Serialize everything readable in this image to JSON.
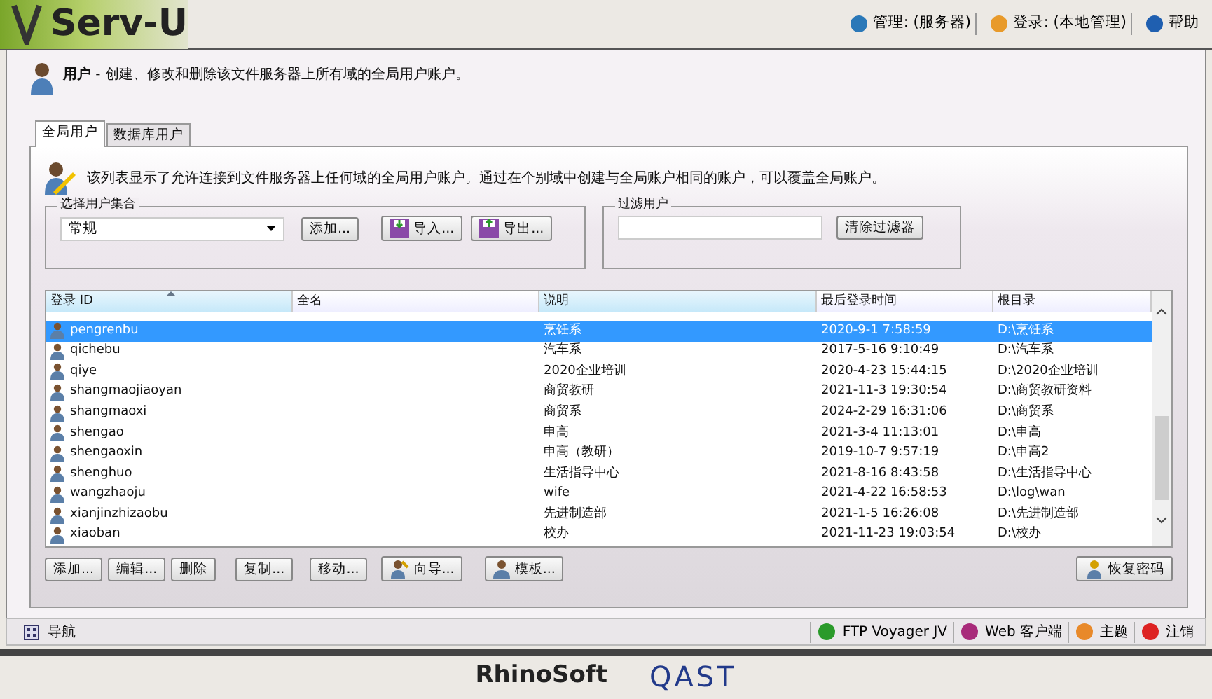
{
  "header": {
    "logo": "Serv-U",
    "toolbar": [
      {
        "kind": "server",
        "label": "管理: (服务器)"
      },
      {
        "kind": "user",
        "label": "登录: (本地管理)"
      },
      {
        "kind": "help",
        "label": "帮助"
      }
    ]
  },
  "page": {
    "title": "用户",
    "subtitle": " - 创建、修改和删除该文件服务器上所有域的全局用户账户。"
  },
  "tabs": [
    {
      "label": "全局用户",
      "selected": true
    },
    {
      "label": "数据库用户",
      "selected": false
    }
  ],
  "description": "该列表显示了允许连接到文件服务器上任何域的全局用户账户。通过在个别域中创建与全局账户相同的账户，可以覆盖全局账户。",
  "user_collection": {
    "legend": "选择用户集合",
    "value": "常规",
    "buttons": [
      {
        "kind": "plain",
        "label": "添加..."
      },
      {
        "kind": "import",
        "label": "导入..."
      },
      {
        "kind": "export",
        "label": "导出..."
      }
    ]
  },
  "filter": {
    "legend": "过滤用户",
    "button": "清除过滤器"
  },
  "table": {
    "columns": [
      "登录 ID",
      "全名",
      "说明",
      "最后登录时间",
      "根目录"
    ],
    "rows": [
      {
        "login_id": "pengrenbu",
        "description": "烹饪系",
        "last_login": "2020-9-1 7:58:59",
        "root": "D:\\烹饪系",
        "selected": true
      },
      {
        "login_id": "qichebu",
        "description": "汽车系",
        "last_login": "2017-5-16 9:10:49",
        "root": "D:\\汽车系",
        "selected": false
      },
      {
        "login_id": "qiye",
        "description": "2020企业培训",
        "last_login": "2020-4-23 15:44:15",
        "root": "D:\\2020企业培训",
        "selected": false
      },
      {
        "login_id": "shangmaojiaoyan",
        "description": "商贸教研",
        "last_login": "2021-11-3 19:30:54",
        "root": "D:\\商贸教研资料",
        "selected": false
      },
      {
        "login_id": "shangmaoxi",
        "description": "商贸系",
        "last_login": "2024-2-29 16:31:06",
        "root": "D:\\商贸系",
        "selected": false
      },
      {
        "login_id": "shengao",
        "description": "申高",
        "last_login": "2021-3-4 11:13:01",
        "root": "D:\\申高",
        "selected": false
      },
      {
        "login_id": "shengaoxin",
        "description": "申高（教研）",
        "last_login": "2019-10-7 9:57:19",
        "root": "D:\\申高2",
        "selected": false
      },
      {
        "login_id": "shenghuo",
        "description": "生活指导中心",
        "last_login": "2021-8-16 8:43:58",
        "root": "D:\\生活指导中心",
        "selected": false
      },
      {
        "login_id": "wangzhaoju",
        "description": "wife",
        "last_login": "2021-4-22 16:58:53",
        "root": "D:\\log\\wan",
        "selected": false
      },
      {
        "login_id": "xianjinzhizaobu",
        "description": "先进制造部",
        "last_login": "2021-1-5 16:26:08",
        "root": "D:\\先进制造部",
        "selected": false
      },
      {
        "login_id": "xiaoban",
        "description": "校办",
        "last_login": "2021-11-23 19:03:54",
        "root": "D:\\校办",
        "selected": false
      }
    ]
  },
  "actions": [
    {
      "kind": "plain",
      "label": "添加..."
    },
    {
      "kind": "plain",
      "label": "编辑..."
    },
    {
      "kind": "plain",
      "label": "删除"
    },
    {
      "kind": "plain",
      "label": "复制..."
    },
    {
      "kind": "plain",
      "label": "移动..."
    },
    {
      "kind": "wizard",
      "label": "向导..."
    },
    {
      "kind": "template",
      "label": "模板..."
    },
    {
      "kind": "recover",
      "label": "恢复密码"
    }
  ],
  "status_bar": {
    "left": "导航",
    "items": [
      {
        "kind": "ftp",
        "label": "FTP Voyager JV"
      },
      {
        "kind": "web",
        "label": "Web 客户端"
      },
      {
        "kind": "theme",
        "label": "主题"
      },
      {
        "kind": "logout",
        "label": "注销"
      }
    ]
  },
  "footer": {
    "logos": [
      "RhinoSoft",
      "QAST"
    ]
  }
}
